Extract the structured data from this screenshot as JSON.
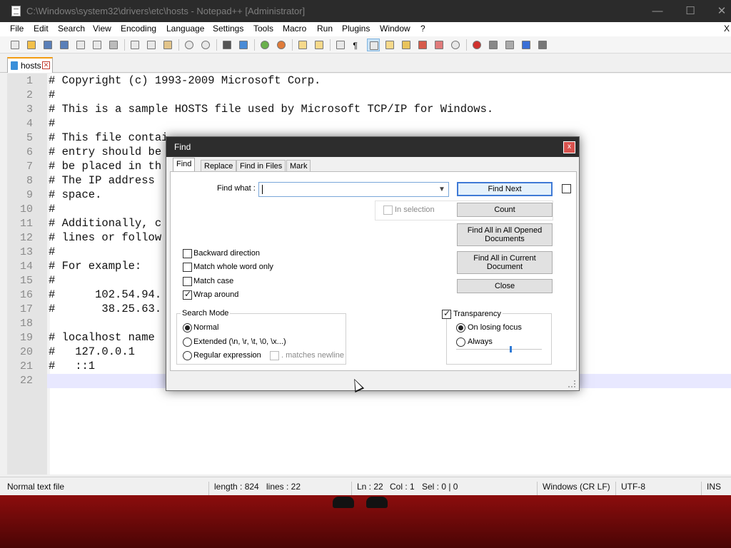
{
  "window": {
    "title": "C:\\Windows\\system32\\drivers\\etc\\hosts - Notepad++ [Administrator]",
    "minimize": "—",
    "maximize": "☐",
    "close": "✕"
  },
  "menu": [
    "File",
    "Edit",
    "Search",
    "View",
    "Encoding",
    "Language",
    "Settings",
    "Tools",
    "Macro",
    "Run",
    "Plugins",
    "Window",
    "?"
  ],
  "menu_overflow": "X",
  "tab": {
    "label": "hosts",
    "close": "✕"
  },
  "editor": {
    "lines": [
      "# Copyright (c) 1993-2009 Microsoft Corp.",
      "#",
      "# This is a sample HOSTS file used by Microsoft TCP/IP for Windows.",
      "#",
      "# This file contai",
      "# entry should be",
      "# be placed in th",
      "# The IP address ",
      "# space.",
      "#",
      "# Additionally, c",
      "# lines or follow",
      "#",
      "# For example:",
      "#",
      "#      102.54.94.",
      "#       38.25.63.",
      "",
      "# localhost name ",
      "#   127.0.0.1",
      "#   ::1",
      ""
    ],
    "line_numbers": [
      "1",
      "2",
      "3",
      "4",
      "5",
      "6",
      "7",
      "8",
      "9",
      "10",
      "11",
      "12",
      "13",
      "14",
      "15",
      "16",
      "17",
      "18",
      "19",
      "20",
      "21",
      "22"
    ]
  },
  "status": {
    "type": "Normal text file",
    "length": "length : 824",
    "lines": "lines : 22",
    "ln": "Ln : 22",
    "col": "Col : 1",
    "sel": "Sel : 0 | 0",
    "eol": "Windows (CR LF)",
    "encoding": "UTF-8",
    "mode": "INS"
  },
  "find_dialog": {
    "title": "Find",
    "close": "x",
    "tabs": [
      "Find",
      "Replace",
      "Find in Files",
      "Mark"
    ],
    "find_what_label": "Find what :",
    "find_what_value": "",
    "buttons": {
      "find_next": "Find Next",
      "count": "Count",
      "find_all_opened_1": "Find All in All Opened",
      "find_all_opened_2": "Documents",
      "find_all_current_1": "Find All in Current",
      "find_all_current_2": "Document",
      "close": "Close"
    },
    "in_selection": "In selection",
    "options": {
      "backward": {
        "label": "Backward direction",
        "checked": false
      },
      "whole_word": {
        "label": "Match whole word only",
        "checked": false
      },
      "match_case": {
        "label": "Match case",
        "checked": false
      },
      "wrap_around": {
        "label": "Wrap around",
        "checked": true
      }
    },
    "search_mode": {
      "title": "Search Mode",
      "normal": "Normal",
      "extended": "Extended (\\n, \\r, \\t, \\0, \\x...)",
      "regex": "Regular expression",
      "matches_newline": ". matches newline",
      "selected": "Normal"
    },
    "transparency": {
      "title": "Transparency",
      "checked": true,
      "on_losing_focus": "On losing focus",
      "always": "Always",
      "selected": "On losing focus",
      "level": 0.63
    }
  }
}
